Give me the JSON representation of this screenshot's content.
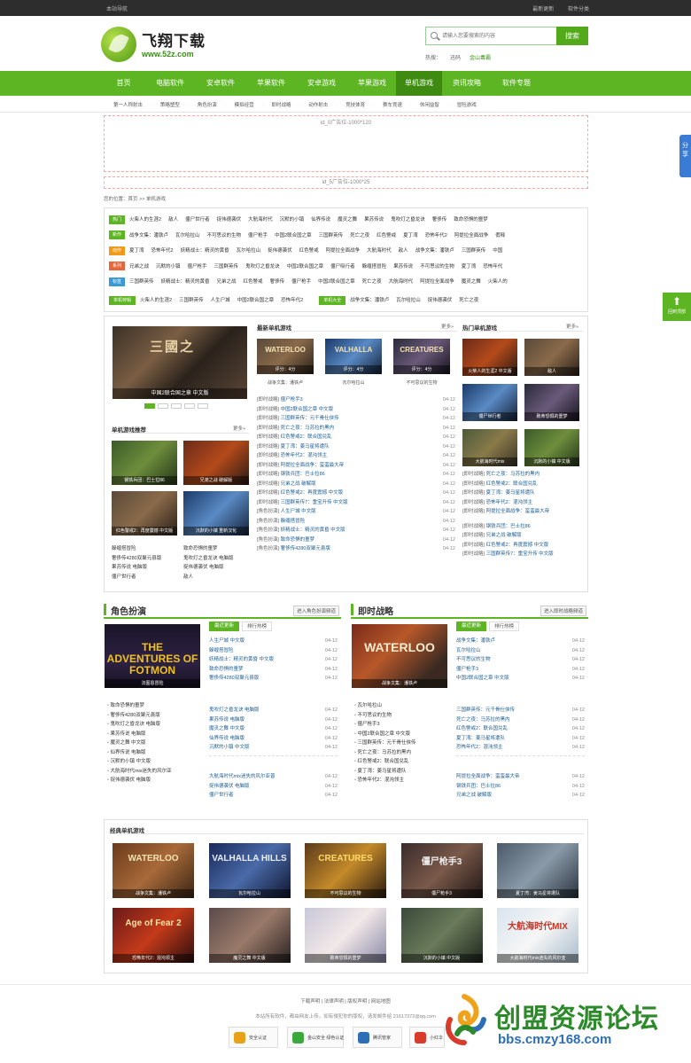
{
  "topbar": {
    "left": "本站导航",
    "right1": "最新更新",
    "right2": "软件分类"
  },
  "logo": {
    "name": "飞翔下载",
    "url": "www.52z.com"
  },
  "search": {
    "placeholder": "请输入您要搜索的内容",
    "button": "搜索"
  },
  "hotwords": {
    "label": "热搜：",
    "w1": "迅码",
    "w2": "金山毒霸"
  },
  "nav": [
    "首页",
    "电脑软件",
    "安卓软件",
    "苹果软件",
    "安卓游戏",
    "苹果游戏",
    "单机游戏",
    "资讯攻略",
    "软件专题"
  ],
  "nav_active": 6,
  "subnav": [
    "第一人称射击",
    "策略塑型",
    "角色扮演",
    "模拟经营",
    "即时战略",
    "动作射击",
    "竞技体育",
    "赛车竞速",
    "休闲益智",
    "冒险游戏"
  ],
  "ads": {
    "a1": "id_0广告位-1000*120",
    "a2": "id_5广告位-1000*25"
  },
  "breadcrumb": "您的位置：首页 >> 单机游戏",
  "tag_rows": [
    {
      "label": "热门",
      "color": "#5db523",
      "items": [
        "火柴人的生涯2",
        "敌人",
        "僵尸世行者",
        "捉伟德袭伏",
        "大航海时代",
        "沉默的小镇",
        "仙界传说",
        "魔灵之舞",
        "果苏传说",
        "鬼吹灯之昏龙诀",
        "奢侈传",
        "致命恐惧的噩梦"
      ]
    },
    {
      "label": "新作",
      "color": "#5db523",
      "items": [
        "战争文集：潘铁卢",
        "瓦尔哈拉山",
        "不可思议的生物",
        "僵尸枪手",
        "中国2联合国之章",
        "三国群英传",
        "死亡之夜",
        "红色警戒",
        "夏丁湾",
        "恐怖年代2",
        "阿提拉全面战争",
        "假释"
      ]
    },
    {
      "label": "动作",
      "color": "#f19a1a",
      "items": [
        "夏丁湾",
        "恐怖年代2",
        "妖精战士：精灵的黄昏",
        "瓦尔哈拉山",
        "捉伟德袭伏",
        "红色警戒",
        "阿提拉全面战争",
        "大航海时代",
        "敌人",
        "战争文集：潘铁卢",
        "三国群英传",
        "中国"
      ]
    },
    {
      "label": "系列",
      "color": "#e8653a",
      "items": [
        "兄弟之战",
        "沉默的小镇",
        "僵尸枪手",
        "三国群英传",
        "鬼吹灯之昏龙诀",
        "中国2联合国之章",
        "僵尸吸行者",
        "躲缠搭冒险",
        "果苏传说",
        "不可思议的生物",
        "夏丁湾",
        "恐怖年代"
      ]
    },
    {
      "label": "标签",
      "color": "#3a9ad9",
      "items": [
        "三国群英传",
        "妖精战士：精灵的黄昏",
        "兄弟之战",
        "红色警戒",
        "奢侈传",
        "僵尸枪手",
        "中国2联合国之章",
        "死亡之夜",
        "大航海时代",
        "阿提拉全面战争",
        "魔灵之舞",
        "火柴人的"
      ]
    }
  ],
  "special_row": {
    "label1": "单机特辑",
    "items1": [
      "火柴人的生涯2",
      "三国群英传",
      "人生尸城",
      "中国2联合国之章",
      "恐怖年代2"
    ],
    "label2": "单机大全",
    "items2": [
      "战争文集：潘铁卢",
      "瓦尔哈拉山",
      "捉伟德袭伏",
      "死亡之夜"
    ]
  },
  "featured": {
    "caption": "中国2联合国之章 中文版"
  },
  "rec": {
    "title": "单机游戏推荐",
    "more": "更多»",
    "thumbs": [
      "钢铁兵团：巴士拉86",
      "兄弟之战 破解版",
      "红色警戒2：再度震撼 中文版",
      "沉默的小镇 重新汉化"
    ],
    "left_list": [
      "躲缠搭冒险",
      "奢侈传4280双聚元县版",
      "果苏传说 电脑版",
      "僵尸世行者"
    ],
    "right_list": [
      "致命恐惧的噩梦",
      "鬼吹灯之昏龙诀 电脑版",
      "捉伟德袭伏 电脑版",
      "敌人"
    ]
  },
  "latest": {
    "title": "最新单机游戏",
    "more": "更多»",
    "thumbs": [
      {
        "cap": "评分：4分",
        "name": "战争文集：潘铁卢"
      },
      {
        "cap": "评分：4分",
        "name": "瓦尔哈拉山"
      },
      {
        "cap": "评分：4分",
        "name": "不可思议的生物"
      }
    ],
    "items": [
      {
        "cat": "[即时战略]",
        "t": "僵尸枪手3",
        "d": "04-12"
      },
      {
        "cat": "[即时战略]",
        "t": "中国2联合国之章 中文版",
        "d": "04-12"
      },
      {
        "cat": "[即时战略]",
        "t": "三国群英传：元千骨仕侠传",
        "d": "04-12"
      },
      {
        "cat": "[即时战略]",
        "t": "死亡之夜：马苏拉的黑内",
        "d": "04-12"
      },
      {
        "cat": "[即时战略]",
        "t": "红色警戒2：联合国兑乱",
        "d": "04-12"
      },
      {
        "cat": "[即时战略]",
        "t": "夏丁湾：姜马星将遭队",
        "d": "04-12"
      },
      {
        "cat": "[即时战略]",
        "t": "恐怖年代2：混沌领主",
        "d": "04-12"
      },
      {
        "cat": "[即时战略]",
        "t": "阿提拉全面战争：蛮蛮最大帝",
        "d": "04-12"
      },
      {
        "cat": "[即时战略]",
        "t": "钢铁兵团：巴士拉86",
        "d": "04-12"
      },
      {
        "cat": "[即时战略]",
        "t": "兄弟之战 破解版",
        "d": "04-12"
      },
      {
        "cat": "[即时战略]",
        "t": "红色警戒2：再度震撼 中文版",
        "d": "04-12"
      },
      {
        "cat": "[即时战略]",
        "t": "三国群英传7：重宝升传 中文版",
        "d": "04-12"
      },
      {
        "cat": "[角色扮演]",
        "t": "人生尸城 中文版",
        "d": "04-12"
      },
      {
        "cat": "[角色扮演]",
        "t": "躲缠搭冒险",
        "d": "04-12"
      },
      {
        "cat": "[角色扮演]",
        "t": "妖精战士：精灵的黄昏 中文版",
        "d": "04-12"
      },
      {
        "cat": "[角色扮演]",
        "t": "致命恐惧的噩梦",
        "d": "04-12"
      },
      {
        "cat": "[角色扮演]",
        "t": "奢侈传4280双聚元县版",
        "d": "04-12"
      }
    ]
  },
  "hot": {
    "title": "热门单机游戏",
    "more": "更多»",
    "thumbs": [
      "火柴人的生涯2 中文版",
      "敌人",
      "僵尸世行者",
      "致命恐惧的噩梦",
      "大航海时代mix",
      "沉默的小镇 中文版"
    ],
    "items": [
      {
        "cat": "[即时战略]",
        "t": "死亡之夜：马苏拉的黑内"
      },
      {
        "cat": "[即时战略]",
        "t": "红色警戒2：联合国兑乱"
      },
      {
        "cat": "[即时战略]",
        "t": "夏丁湾：姜马星将遭队"
      },
      {
        "cat": "[即时战略]",
        "t": "恐怖年代2：混沌领主"
      },
      {
        "cat": "[即时战略]",
        "t": "阿提拉全面战争：蛮蛮最大帝"
      },
      {
        "cat": "[即时战略]",
        "t": "钢铁兵团：巴士拉86"
      },
      {
        "cat": "[即时战略]",
        "t": "兄弟之战 破解版"
      },
      {
        "cat": "[即时战略]",
        "t": "红色警戒2：再度震撼 中文版"
      },
      {
        "cat": "[即时战略]",
        "t": "三国群英传7：重宝升传 中文版"
      }
    ]
  },
  "rpg": {
    "title": "角色扮演",
    "entry": "进入角色扮演频道",
    "tab_on": "最近更新",
    "tab_off": "排行热榜",
    "cover": "THE ADVENTURES OF FOTMON",
    "cover_cap": "法图恩冒险",
    "list_a": [
      {
        "t": "人生尸城 中文版",
        "d": "04-12"
      },
      {
        "t": "躲缠搭冒险",
        "d": "04-12"
      },
      {
        "t": "妖精战士：精灵的黄昏 中文版",
        "d": "04-12"
      },
      {
        "t": "致命恐惧的噩梦",
        "d": "04-12"
      },
      {
        "t": "奢侈传4280双聚元县版",
        "d": "04-12"
      }
    ],
    "list_left": [
      "致命恐惧的噩梦",
      "奢侈传4280双聚元县版",
      "鬼吹灯之昏龙诀 电脑版",
      "果苏传说 电脑版",
      "魔灵之舞 中文版",
      "仙界传说 电脑版",
      "沉默的小镇 中文版",
      "大航海时代mix迷失的风尔亚",
      "捉伟德袭伏 电脑版"
    ],
    "list_b": [
      {
        "t": "鬼吹灯之昏龙诀 电脑版",
        "d": "04-12"
      },
      {
        "t": "果苏传说 电脑版",
        "d": "04-12"
      },
      {
        "t": "魔灵之舞 中文版",
        "d": "04-12"
      },
      {
        "t": "仙界传说 电脑版",
        "d": "04-12"
      },
      {
        "t": "沉默的小镇 中文版",
        "d": "04-12"
      }
    ],
    "list_c": [
      {
        "t": "大航海时代mix迷失的风尔亚普",
        "d": "04-12"
      },
      {
        "t": "捉伟德袭伏 电脑版",
        "d": "04-12"
      },
      {
        "t": "僵尸世行者",
        "d": "04-12"
      }
    ]
  },
  "rts": {
    "title": "即时战略",
    "entry": "进入即时战略频道",
    "tab_on": "最近更新",
    "tab_off": "排行热榜",
    "cover": "WATERLOO",
    "cover_cap": "战争文集：潘铁卢",
    "list_a": [
      {
        "t": "战争文集：潘铁卢",
        "d": "04-12"
      },
      {
        "t": "瓦尔哈拉山",
        "d": "04-12"
      },
      {
        "t": "不可思议的生物",
        "d": "04-12"
      },
      {
        "t": "僵尸枪手3",
        "d": "04-12"
      },
      {
        "t": "中国2联合国之章 中文版",
        "d": "04-12"
      }
    ],
    "list_left": [
      "瓦尔哈拉山",
      "不可思议的生物",
      "僵尸枪手3",
      "中国2联合国之章 中文版",
      "三国群英传：元千骨仕侠传",
      "死亡之夜：马苏拉的黑内",
      "红色警戒2：联合国兑乱",
      "夏丁湾：姜马星将遭队",
      "恐怖年代2：混沌领主"
    ],
    "list_b": [
      {
        "t": "三国群英传：元千骨仕侠传",
        "d": "04-12"
      },
      {
        "t": "死亡之夜：马苏拉的黑内",
        "d": "04-12"
      },
      {
        "t": "红色警戒2：联合国兑乱",
        "d": "04-12"
      },
      {
        "t": "夏丁湾：姜马星将遭队",
        "d": "04-12"
      },
      {
        "t": "恐怖年代2：混沌领主",
        "d": "04-12"
      }
    ],
    "list_c": [
      {
        "t": "阿提拉全面战争：蛮蛮最大帝",
        "d": "04-12"
      },
      {
        "t": "钢铁兵团：巴士拉86",
        "d": "04-12"
      },
      {
        "t": "兄弟之战 破解版",
        "d": "04-12"
      }
    ]
  },
  "classic": {
    "title": "经典单机游戏",
    "items": [
      "战争文集：潘铁卢",
      "瓦尔哈拉山",
      "不可思议的生物",
      "僵尸枪手3",
      "夏丁湾：姜马星将遭队",
      "恐怖年代2：混沌领主",
      "魔灵之舞 中文版",
      "致命恐惧的噩梦",
      "沉默的小镇 中文版",
      "大航海时代mix迷失的风尔亚"
    ],
    "art": [
      "WATERLOO",
      "VALHALLA HILLS",
      "CREATURES",
      "僵尸枪手3",
      "",
      "Age of Fear 2",
      "",
      "",
      "",
      "大航海时代MIX"
    ]
  },
  "footer": {
    "links": "下载声明 | 法律声明 | 版权声明 | 网站地图",
    "copy": "本站所有软件，都由网友上传，如有侵犯你的版权，请发邮件给 21617372@qq.com",
    "badges": [
      "安全认证",
      "金山安全 绿色认证",
      "腾讯管家",
      "小红伞"
    ]
  },
  "side": {
    "share": "分享",
    "backtop": "回到顶部"
  },
  "watermark": {
    "t1": "创盟资源论坛",
    "t2": "bbs.cmzy168.com"
  }
}
